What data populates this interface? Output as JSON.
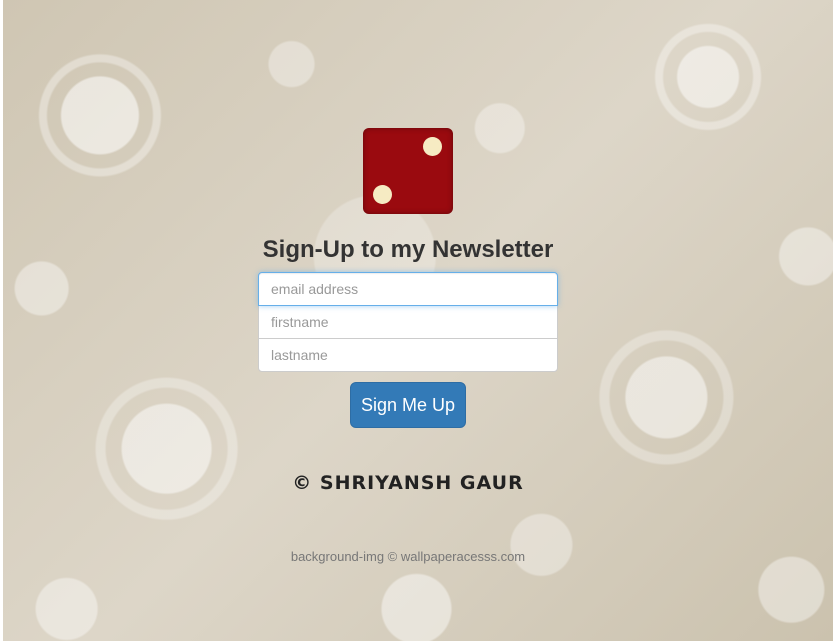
{
  "logo": {
    "icon": "dice-icon",
    "color": "#9a0a0f",
    "pip_color": "#f6ebc3"
  },
  "heading": "Sign-Up to my Newsletter",
  "form": {
    "email_placeholder": "email address",
    "firstname_placeholder": "firstname",
    "lastname_placeholder": "lastname",
    "submit_label": "Sign Me Up"
  },
  "footer": {
    "copyright": "© SHRIYANSH GAUR",
    "credit": "background-img © wallpaperacesss.com"
  },
  "colors": {
    "accent": "#337ab7",
    "heading": "#333333"
  }
}
